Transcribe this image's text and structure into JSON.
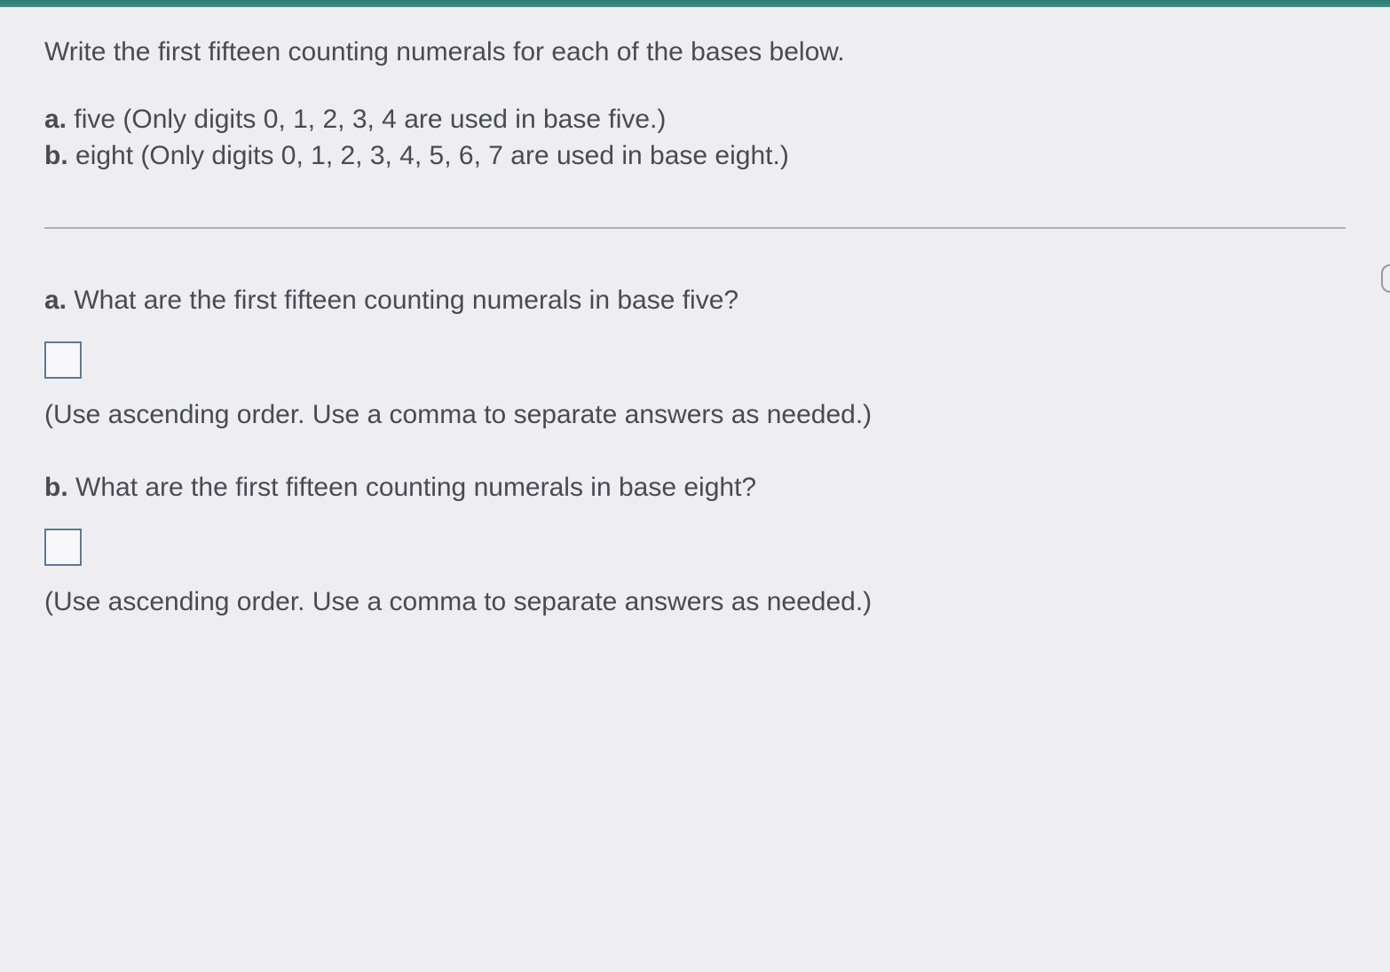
{
  "question": {
    "intro": "Write the first fifteen counting numerals for each of the bases below.",
    "items": [
      {
        "label": "a.",
        "text": " five (Only digits 0, 1, 2, 3, 4 are used in base five.)"
      },
      {
        "label": "b.",
        "text": " eight (Only digits 0, 1, 2, 3, 4, 5, 6, 7 are used in base eight.)"
      }
    ]
  },
  "parts": [
    {
      "label": "a.",
      "question": " What are the first fifteen counting numerals in base five?",
      "hint": "(Use ascending order. Use a comma to separate answers as needed.)",
      "value": ""
    },
    {
      "label": "b.",
      "question": " What are the first fifteen counting numerals in base eight?",
      "hint": "(Use ascending order. Use a comma to separate answers as needed.)",
      "value": ""
    }
  ]
}
